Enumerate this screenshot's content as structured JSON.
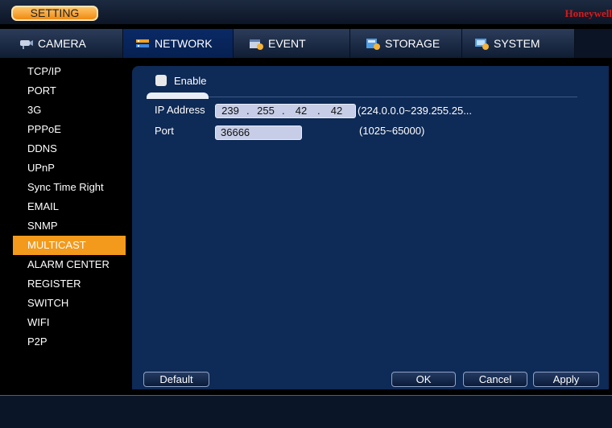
{
  "window": {
    "setting_label": "SETTING",
    "brand": "Honeywell"
  },
  "tabs": [
    {
      "label": "CAMERA",
      "icon": "camera-icon"
    },
    {
      "label": "NETWORK",
      "icon": "network-icon",
      "active": true
    },
    {
      "label": "EVENT",
      "icon": "event-icon"
    },
    {
      "label": "STORAGE",
      "icon": "storage-icon"
    },
    {
      "label": "SYSTEM",
      "icon": "system-icon"
    }
  ],
  "sidebar": {
    "items": [
      {
        "label": "TCP/IP"
      },
      {
        "label": "PORT"
      },
      {
        "label": "3G"
      },
      {
        "label": "PPPoE"
      },
      {
        "label": "DDNS"
      },
      {
        "label": "UPnP"
      },
      {
        "label": "Sync Time Right"
      },
      {
        "label": "EMAIL"
      },
      {
        "label": "SNMP"
      },
      {
        "label": "MULTICAST",
        "active": true
      },
      {
        "label": "ALARM CENTER"
      },
      {
        "label": "REGISTER"
      },
      {
        "label": "SWITCH"
      },
      {
        "label": "WIFI"
      },
      {
        "label": "P2P"
      }
    ]
  },
  "multicast": {
    "enable_label": "Enable",
    "enabled": false,
    "ip_label": "IP Address",
    "ip": [
      "239",
      "255",
      "42",
      "42"
    ],
    "ip_hint": "(224.0.0.0~239.255.25...",
    "port_label": "Port",
    "port": "36666",
    "port_hint": "(1025~65000)"
  },
  "buttons": {
    "default": "Default",
    "ok": "OK",
    "cancel": "Cancel",
    "apply": "Apply"
  },
  "colors": {
    "accent": "#f39a1c",
    "panel": "#0e2a56",
    "field": "#c7cde6"
  }
}
